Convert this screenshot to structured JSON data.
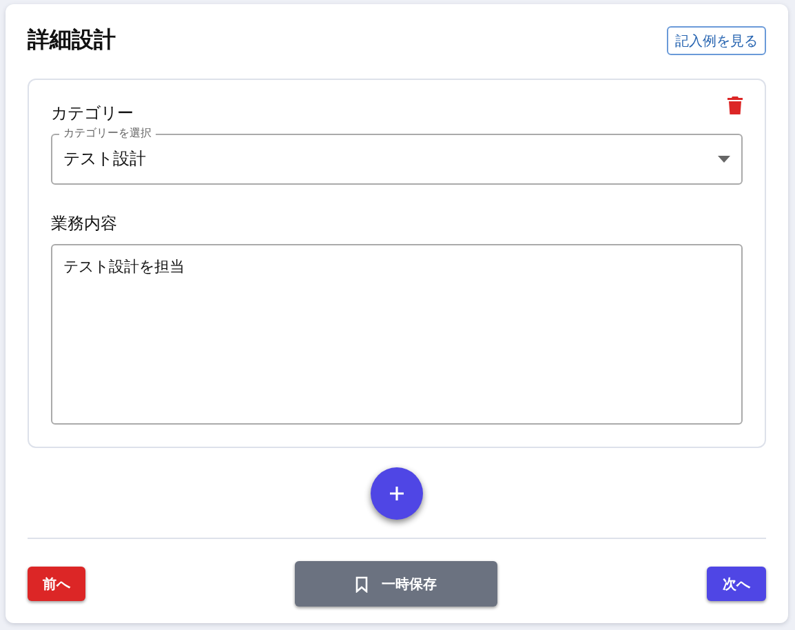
{
  "title": "詳細設計",
  "example_button": "記入例を見る",
  "entries": [
    {
      "category_label": "カテゴリー",
      "select_legend": "カテゴリーを選択",
      "select_value": "テスト設計",
      "content_label": "業務内容",
      "content_value": "テスト設計を担当"
    }
  ],
  "footer": {
    "prev": "前へ",
    "save": "一時保存",
    "next": "次へ"
  }
}
